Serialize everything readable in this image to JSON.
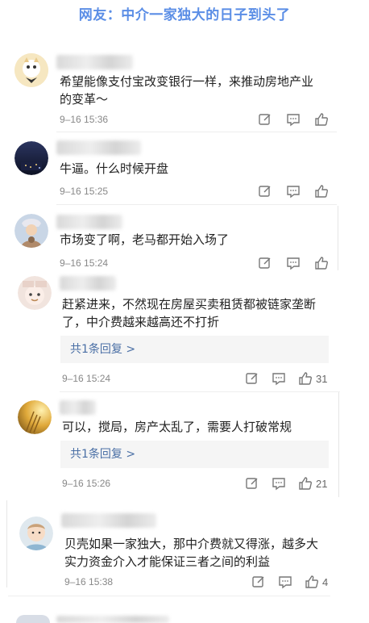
{
  "headline": "网友：中介一家独大的日子到头了",
  "comments": [
    {
      "text": "希望能像支付宝改变银行一样，来推动房地产业\n的变革～",
      "time": "9–16 15:36"
    },
    {
      "text": "牛逼。什么时候开盘",
      "time": "9–16 15:25"
    },
    {
      "text": "市场变了啊，老马都开始入场了",
      "time": "9–16 15:24"
    },
    {
      "text": "赶紧进来，不然现在房屋买卖租赁都被链家垄断\n了，中介费越来越高还不打折",
      "time": "9–16 15:24",
      "reply": "共1条回复 >",
      "likes": "31"
    },
    {
      "text": "可以，搅局，房产太乱了，需要人打破常规",
      "time": "9–16 15:26",
      "reply": "共1条回复 >",
      "likes": "21"
    },
    {
      "text": "贝壳如果一家独大，那中介费就又得涨，越多大\n实力资金介入才能保证三者之间的利益",
      "time": "9–16 15:38",
      "likes": "4"
    }
  ],
  "icons": {
    "edit": "edit-icon",
    "comment": "comment-icon",
    "like": "thumbs-up-icon"
  },
  "colors": {
    "headline": "#5b8ee6",
    "reply_link": "#4a6fa5"
  }
}
